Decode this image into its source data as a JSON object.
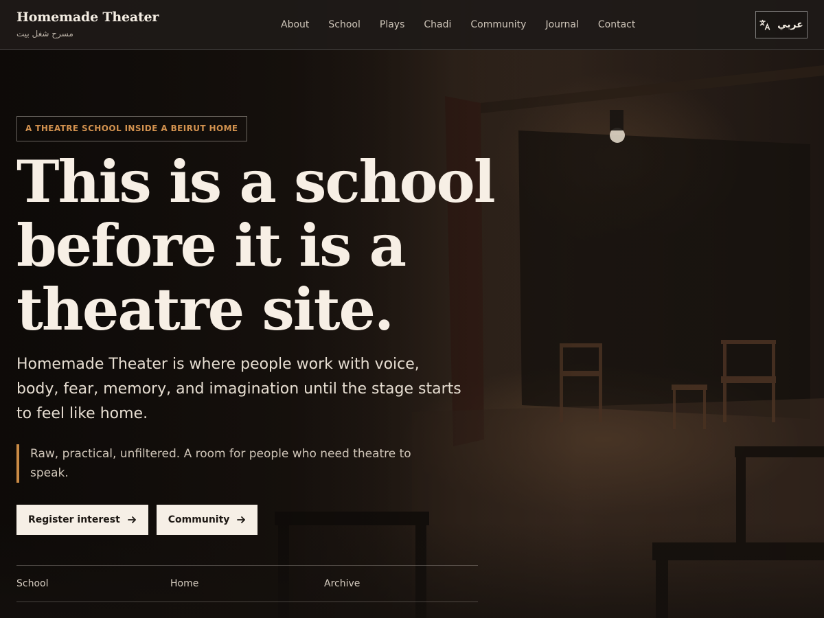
{
  "header": {
    "brand_title": "Homemade Theater",
    "brand_subtitle": "مسرح شغل بيت",
    "nav": [
      "About",
      "School",
      "Plays",
      "Chadi",
      "Community",
      "Journal",
      "Contact"
    ],
    "language_button": {
      "label": "عربي",
      "icon": "translate-icon"
    }
  },
  "hero": {
    "eyebrow": "A THEATRE SCHOOL INSIDE A BEIRUT HOME",
    "headline": "This is a school before it is a theatre site.",
    "lede": "Homemade Theater is where people work with voice, body, fear, memory, and imagination until the stage starts to feel like home.",
    "quote": "Raw, practical, unfiltered. A room for people who need theatre to speak.",
    "cta_primary": "Register interest",
    "cta_secondary": "Community",
    "cta_icon": "arrow-right-icon"
  },
  "tabs": [
    "School",
    "Home",
    "Archive"
  ],
  "colors": {
    "accent": "#c98a45",
    "eyebrow_text": "#d3924f",
    "button_bg": "#f6efe6",
    "header_bg": "#1e1a18"
  }
}
